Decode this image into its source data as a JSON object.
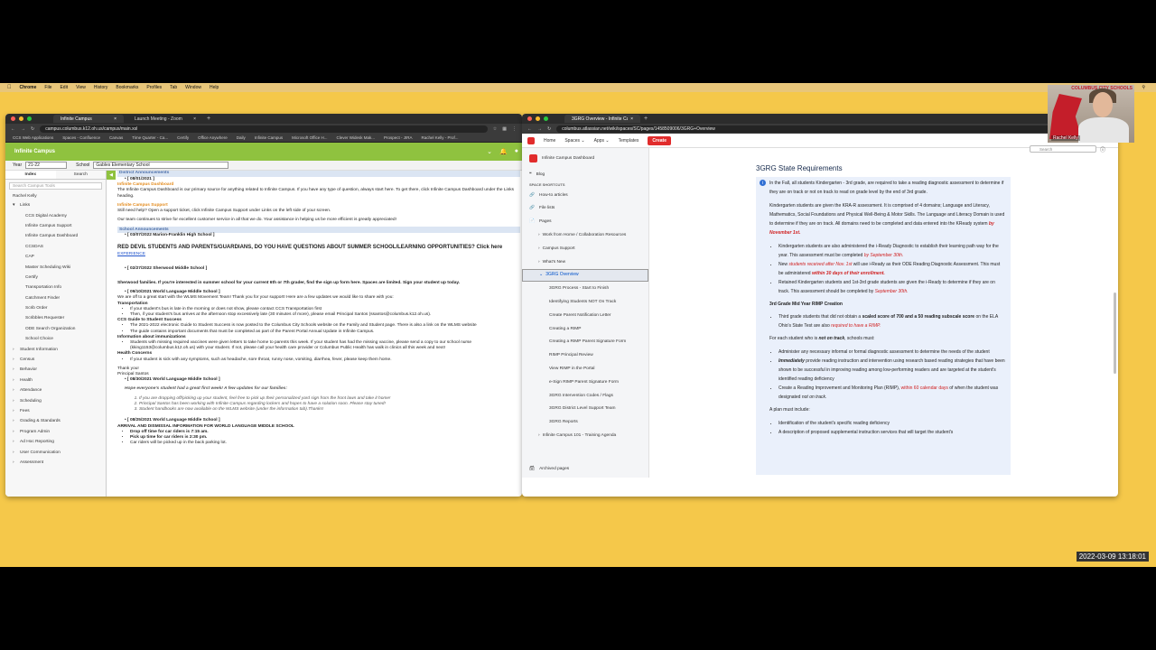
{
  "menubar": {
    "items": [
      "Chrome",
      "File",
      "Edit",
      "View",
      "History",
      "Bookmarks",
      "Profiles",
      "Tab",
      "Window",
      "Help"
    ]
  },
  "left_window": {
    "tabs": [
      "Infinite Campus",
      "Launch Meeting - Zoom"
    ],
    "url": "campus.columbus.k12.oh.us/campus/main.xsl",
    "bookmarks": [
      "CCS Web Applications",
      "Spaces - Confluence",
      "Canvas",
      "Time Quarter - Ca...",
      "Certify",
      "Office Anywhere",
      "Daily",
      "Infinite Campus",
      "Microsoft Office H...",
      "Clever Widesk Mak...",
      "Prospect - JIRA",
      "Rachel Kelly - Prof..."
    ],
    "logo": "Infinite Campus",
    "year_label": "Year",
    "year_value": "21-22",
    "school_label": "School",
    "school_value": "Gables Elementary School",
    "nav_tabs": [
      "Index",
      "Search"
    ],
    "search_placeholder": "Search Campus Tools",
    "user": "Rachel Kelly",
    "nav_items": [
      {
        "label": "Links",
        "sub": false
      },
      {
        "label": "CCS Digital Academy",
        "sub": true
      },
      {
        "label": "Infinite Campus Support",
        "sub": true
      },
      {
        "label": "Infinite Campus Dashboard",
        "sub": true
      },
      {
        "label": "CCSDAS",
        "sub": true
      },
      {
        "label": "CAP",
        "sub": true
      },
      {
        "label": "Master Scheduling Wiki",
        "sub": true
      },
      {
        "label": "Certify",
        "sub": true
      },
      {
        "label": "Transportation Info",
        "sub": true
      },
      {
        "label": "Catchment Finder",
        "sub": true
      },
      {
        "label": "Scrib Order",
        "sub": true
      },
      {
        "label": "Scribbles Requester",
        "sub": true
      },
      {
        "label": "ODE Search Organization",
        "sub": true
      },
      {
        "label": "School Choice",
        "sub": true
      },
      {
        "label": "Student Information",
        "sub": false
      },
      {
        "label": "Census",
        "sub": false
      },
      {
        "label": "Behavior",
        "sub": false
      },
      {
        "label": "Health",
        "sub": false
      },
      {
        "label": "Attendance",
        "sub": false
      },
      {
        "label": "Scheduling",
        "sub": false
      },
      {
        "label": "Fees",
        "sub": false
      },
      {
        "label": "Grading & Standards",
        "sub": false
      },
      {
        "label": "Program Admin",
        "sub": false
      },
      {
        "label": "Ad Hoc Reporting",
        "sub": false
      },
      {
        "label": "User Communication",
        "sub": false
      },
      {
        "label": "Assessment",
        "sub": false
      }
    ],
    "content": {
      "district_header": "District Announcements",
      "d1_date": "[ 08/01/2021 ]",
      "d1_title": "Infinite Campus Dashboard",
      "d1_text": "The Infinite Campus Dashboard is our primary source for anything related to Infinite Campus.  If you have any type of question, always start here.  To get there, click Infinite Campus Dashboard under the Links heading.",
      "d1_title2": "Infinite Campus Support",
      "d1_text2": "Still need help?  Open a support ticket, click Infinite Campus Support under Links on the left side of your screen.",
      "d1_text3": "Our team continues to strive for excellent customer service in all that we do.  Your assistance in helping us be more efficient is greatly appreciated!",
      "school_header": "School Announcements",
      "s1_date": "[ 03/07/2022 Marion-Franklin High School ]",
      "s1_big": "RED DEVIL STUDENTS AND PARENTS/GUARDIANS, DO YOU HAVE QUESTIONS ABOUT SUMMER SCHOOL/LEARNING OPPORTUNITIES?  Click here",
      "s1_link": "EXPERIENCE",
      "s2_date": "[ 02/27/2022 Sherwood Middle School ]",
      "s2_text": "Sherwood families. If you're interested in summer school for your current 6th or 7th grader, find the sign up form here. Spaces are limited. Sign your student up today.",
      "s3_date": "[ 09/10/2021 World Language Middle School ]",
      "s3_intro": "We are off to a great start with the WLMS Movement Team! Thank you for your support! Here are a few updates we would like to share with you:",
      "s3_h1": "Transportation",
      "s3_b1": "If your student's bus is late in the morning or does not show, please contact CCS Transportation first",
      "s3_b2": "Then, if your student's bus arrives at the afternoon stop excessively late (30 minutes of more), please email Principal Santos (ssantos@columbus.k12.oh.us).",
      "s3_h2": "CCS Guide to Student Success",
      "s3_b3": "The 2021-2022 electronic Guide to Student Success is now posted to the Columbus City Schools website on the Family and Student page. There is also a link on the WLMS website",
      "s3_b4": "The guide contains important documents that must be completed as part of the Parent Portal Annual Update in Infinite Campus.",
      "s3_h3": "Information about immunizations",
      "s3_b5": "Students with missing required vaccines were given letters to take home to parents this week. If your student has had the missing vaccine, please send a copy to our school nurse (kking1153@columbus.k12.oh.us) with your student. If not, please call your health care provider or Columbus Public Health has walk in clinics all this week and next!",
      "s3_h4": "Health Concerns",
      "s3_b6": "If your student is sick with any symptoms, such as headache, sore throat, runny nose, vomiting, diarrhea, fever, please keep them home.",
      "s3_thanks": "Thank you!",
      "s3_sign": "Principal Santos",
      "s4_date": "[ 08/30/2021 World Language Middle School ]",
      "s4_intro": "Hope everyone's student had a great first week! A few updates for our families:",
      "s4_l1": "If you are dropping off/picking up your student, feel free to pick up their personalized yard sign from the front lawn and take it home!",
      "s4_l2": "Principal Santos has been working with Infinite Campus regarding lockers and hopes to have a solution soon. Please stay tuned!",
      "s4_l3": "Student handbooks are now available on the WLMS website (under the information tab).Thanks!",
      "s5_date": "[ 08/25/2021 World Language Middle School ]",
      "s5_title": "ARRIVAL AND DISMISSAL INFORMATION FOR WORLD LANGUAGE MIDDLE SCHOOL",
      "s5_b1": "Drop off time for car riders is 7:15 am.",
      "s5_b2": "Pick up time for car riders is 2:30 pm.",
      "s5_b3": "Car riders will be picked up in the back parking lot."
    }
  },
  "right_window": {
    "tab": "3GRG Overview - Infinite Campus",
    "url": "columbus.atlassian.net/wiki/spaces/SC/pages/1458509006/3GRG+Overview",
    "nav": [
      "Home",
      "Spaces",
      "Apps",
      "Templates"
    ],
    "create_label": "Create",
    "search_placeholder": "Search",
    "space_name": "Infinite Campus Dashboard",
    "blog": "Blog",
    "shortcuts_label": "SPACE SHORTCUTS",
    "shortcuts": [
      "How-to articles",
      "File lists"
    ],
    "pages_label": "Pages",
    "tree": [
      {
        "label": "Work from Home / Collaboration Resources",
        "depth": 1,
        "selected": false
      },
      {
        "label": "Campus Support",
        "depth": 1,
        "selected": false
      },
      {
        "label": "What's New",
        "depth": 1,
        "selected": false
      },
      {
        "label": "3GRG Overview",
        "depth": 1,
        "selected": true
      },
      {
        "label": "3GRG Process - Start to Finish",
        "depth": 2,
        "selected": false
      },
      {
        "label": "Identifying Students NOT On Track",
        "depth": 2,
        "selected": false
      },
      {
        "label": "Create Parent Notification Letter",
        "depth": 2,
        "selected": false
      },
      {
        "label": "Creating a RIMP",
        "depth": 2,
        "selected": false
      },
      {
        "label": "Creating a RIMP Parent Signature Form",
        "depth": 2,
        "selected": false
      },
      {
        "label": "RIMP Principal Review",
        "depth": 2,
        "selected": false
      },
      {
        "label": "View RIMP in the Portal",
        "depth": 2,
        "selected": false
      },
      {
        "label": "e-Sign RIMP Parent Signature Form",
        "depth": 2,
        "selected": false
      },
      {
        "label": "3GRG Intervention Codes / Flags",
        "depth": 2,
        "selected": false
      },
      {
        "label": "3GRG District Level Support Team",
        "depth": 2,
        "selected": false
      },
      {
        "label": "3GRG Reports",
        "depth": 2,
        "selected": false
      },
      {
        "label": "Infinite Campus 101 - Training Agenda",
        "depth": 1,
        "selected": false
      }
    ],
    "archived": "Archived pages",
    "heading": "3GRG State Requirements",
    "p1": "In the Fall, all students Kindergarten - 3rd grade, are required to take a reading diagnostic assessment to determine if they are on track or not on track to read on grade level by the end of 3rd grade.",
    "p2a": "Kindergarten students are given the KRA-R assessment.  It is comprised of 4 domains; Language and Literacy, Mathematics, Social Foundations and Physical Well-Being & Motor Skills.  The Language and Literacy Domain is used to determine if they are on track.  All domains need to be completed and data entered into the KReady system ",
    "p2b": "by November 1st.",
    "b1a": "Kindergarten students are also administered the i-Ready Diagnostic to establish their learning path way for the year.  This assessment must be completed ",
    "b1b": "by September 30th.",
    "b2a": "New ",
    "b2b": "students received after Nov. 1st",
    "b2c": " will use i-Ready as their ODE Reading Diagnostic Assessment. This must be administered ",
    "b2d": "within 30 days of their enrollment.",
    "b3a": "Retained Kindergarten students and 1st-3rd grade students are given the i-Ready to determine if they are on track. This assessment should be completed by ",
    "b3b": "September 30th.",
    "h_mid": "3rd Grade Mid Year RIMP Creation",
    "m1a": "Third grade students that did not obtain a ",
    "m1b": "scaled score of 700 and a 50 reading subscale score",
    "m1c": " on the ELA Ohio's State Test are also ",
    "m1d": "required to have a RIMP.",
    "p3a": "For each student who is ",
    "p3b": "not on track",
    "p3c": ", schools must:",
    "c1": "Administer any necessary informal or formal diagnostic assessment to determine the needs of the student",
    "c2a": "Immediately",
    "c2b": " provide reading instruction and intervention using research based reading strategies that have been shown to be successful in improving reading among low-performing readers and are targeted at the student's identified reading deficiency",
    "c3a": "Create a Reading Improvement and Monitoring Plan (RIMP), ",
    "c3b": "within 60 calendar days",
    "c3c": " of when the student was designated ",
    "c3d": "not on track",
    "c3e": ".",
    "p4": "A plan must include:",
    "i1": "Identification of the student's specific reading deficiency",
    "i2": "A description of proposed supplemental instruction services that will target the student's"
  },
  "webcam": {
    "name": "Rachel Kelly",
    "logo": "COLUMBUS CITY SCHOOLS"
  },
  "timestamp": "2022-03-09  13:18:01"
}
